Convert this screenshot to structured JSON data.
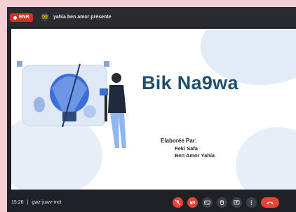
{
  "recording": {
    "label": "ENR"
  },
  "presenter": {
    "text": "yahia ben amor présente"
  },
  "slide": {
    "title": "Bik Na9wa",
    "authors_label": "Elaborée Par:",
    "authors": [
      "Feki Safa",
      "Ben Amor Yahia"
    ]
  },
  "meeting": {
    "time": "15:26",
    "separator": "|",
    "code": "gwz-juwv-mct"
  },
  "controls": [
    {
      "name": "mic-off-button",
      "icon": "mic-off-icon"
    },
    {
      "name": "camera-off-button",
      "icon": "camera-off-icon"
    },
    {
      "name": "captions-button",
      "icon": "captions-icon"
    },
    {
      "name": "raise-hand-button",
      "icon": "hand-icon"
    },
    {
      "name": "present-button",
      "icon": "present-icon"
    },
    {
      "name": "more-options-button",
      "icon": "more-vert-icon"
    }
  ],
  "colors": {
    "accent_red": "#ea4335",
    "title_blue": "#1f4f72",
    "bar": "#202124"
  }
}
